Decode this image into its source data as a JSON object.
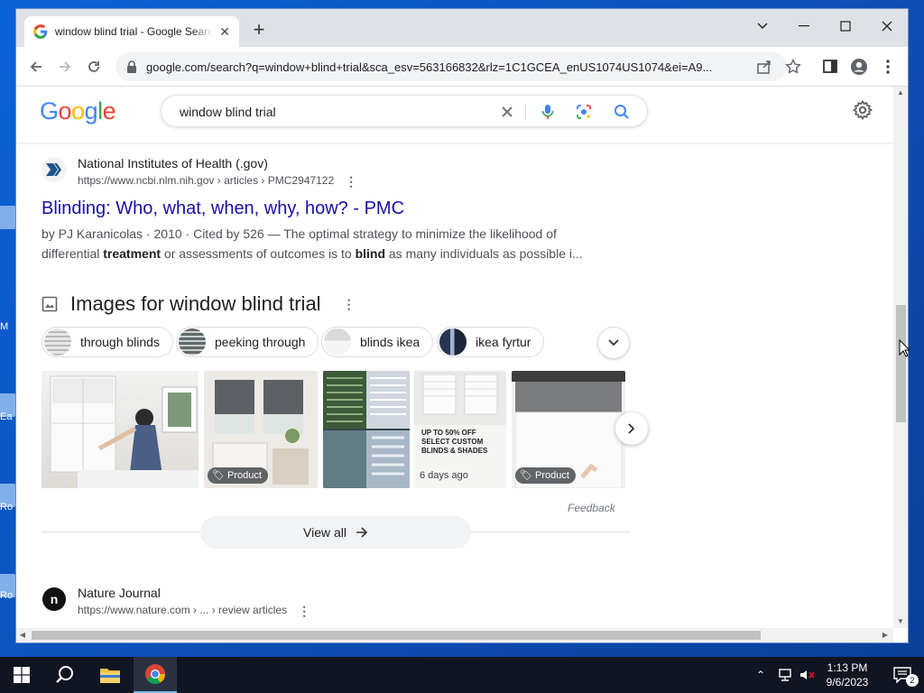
{
  "browser": {
    "tab_title": "window blind trial - Google Search",
    "url": "google.com/search?q=window+blind+trial&sca_esv=563166832&rlz=1C1GCEA_enUS1074US1074&ei=A9..."
  },
  "search": {
    "logo": "Google",
    "query": "window blind trial"
  },
  "result1": {
    "source_name": "National Institutes of Health (.gov)",
    "url": "https://www.ncbi.nlm.nih.gov › articles › PMC2947122",
    "title": "Blinding: Who, what, when, why, how? - PMC",
    "meta": "by PJ Karanicolas · 2010 · Cited by 526 —",
    "snippet_a": " The optimal strategy to minimize the likelihood of differential ",
    "snippet_b1": "treatment",
    "snippet_c": " or assessments of outcomes is to ",
    "snippet_b2": "blind",
    "snippet_d": " as many individuals as possible i..."
  },
  "images_section": {
    "heading": "Images for window blind trial",
    "chips": [
      {
        "label": "through blinds"
      },
      {
        "label": "peeking through"
      },
      {
        "label": "blinds ikea"
      },
      {
        "label": "ikea fyrtur"
      }
    ],
    "images": [
      {
        "badge": ""
      },
      {
        "badge": "Product"
      },
      {
        "badge": ""
      },
      {
        "badge": "6 days ago",
        "promo": "UP TO 50% OFF SELECT CUSTOM BLINDS & SHADES"
      },
      {
        "badge": "Product"
      }
    ],
    "feedback": "Feedback",
    "view_all": "View all"
  },
  "result2": {
    "source_name": "Nature Journal",
    "url": "https://www.nature.com › ... › review articles",
    "favicon_letter": "n"
  },
  "taskbar": {
    "time": "1:13 PM",
    "date": "9/6/2023",
    "notifications": "2"
  },
  "desktop_labels": [
    "M",
    "Ea",
    "Ro",
    "Ro"
  ]
}
